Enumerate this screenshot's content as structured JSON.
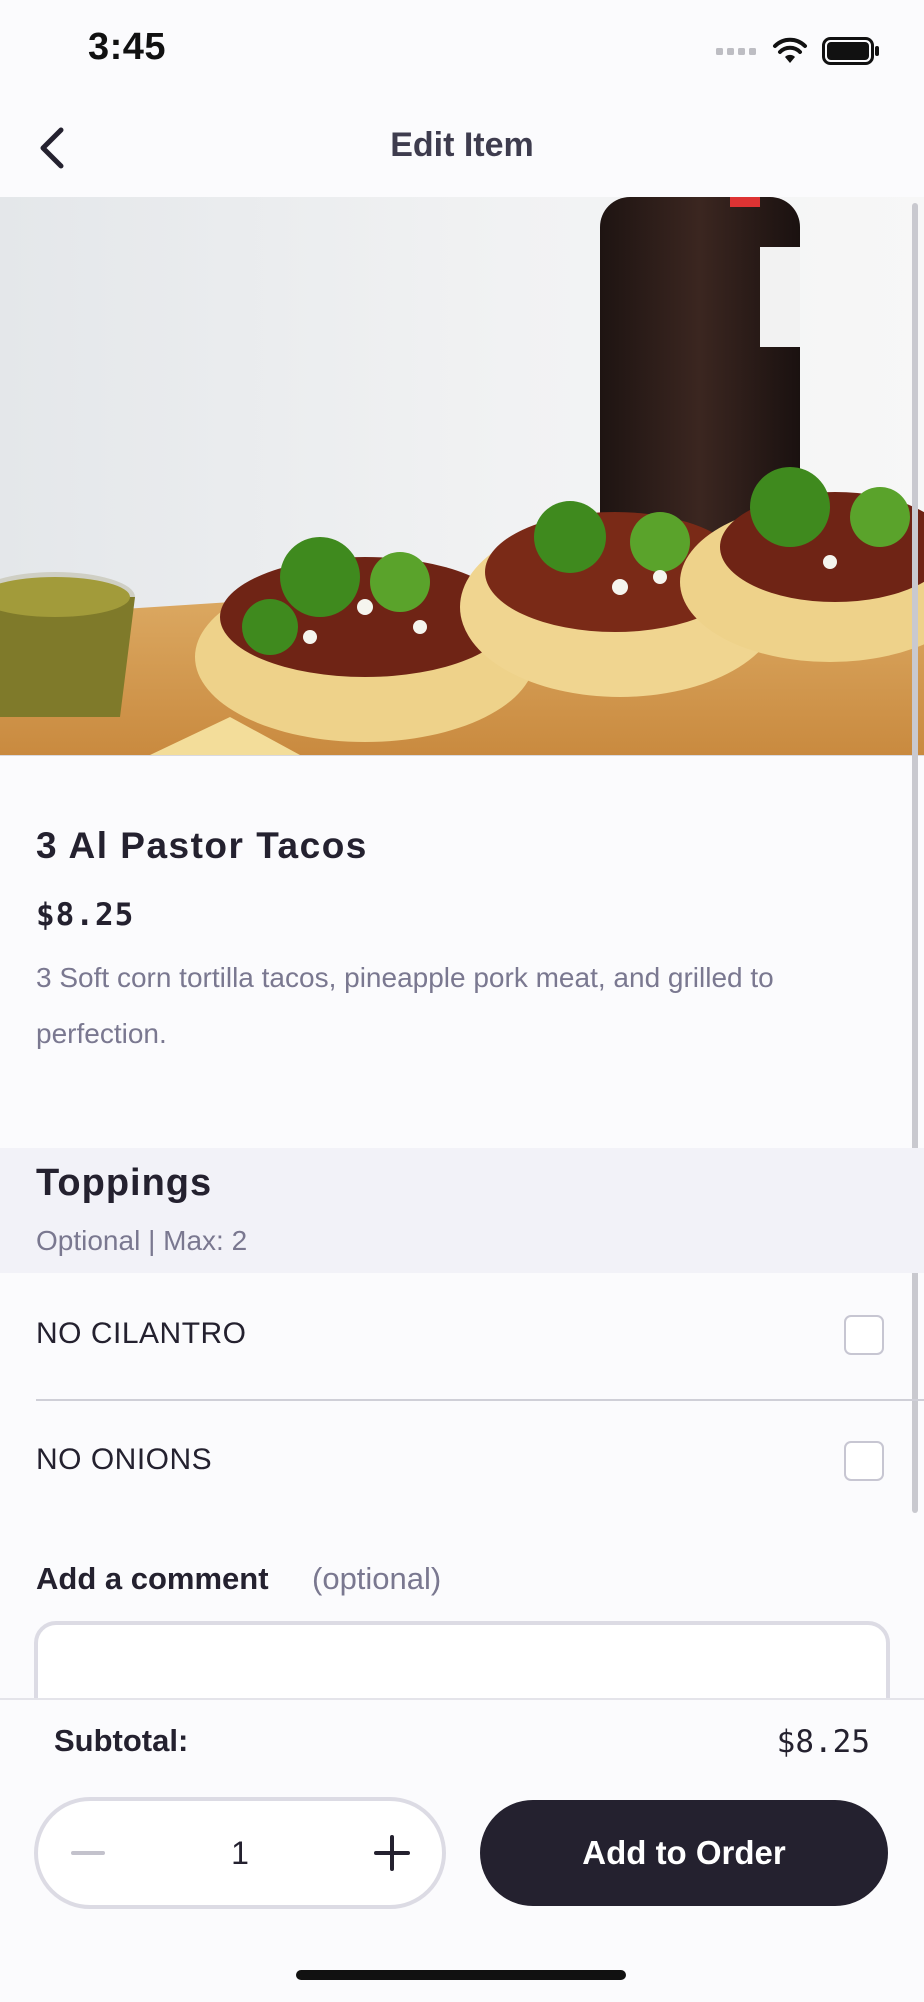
{
  "status_bar": {
    "time": "3:45"
  },
  "nav": {
    "title": "Edit Item"
  },
  "item": {
    "name": "3 Al Pastor Tacos",
    "price": "$8.25",
    "description": "3 Soft corn tortilla tacos, pineapple pork meat, and grilled to perfection."
  },
  "toppings": {
    "title": "Toppings",
    "subtitle": "Optional | Max: 2",
    "options": [
      {
        "label": "NO CILANTRO",
        "checked": false
      },
      {
        "label": "NO ONIONS",
        "checked": false
      }
    ]
  },
  "comment": {
    "label": "Add a comment",
    "optional_label": "(optional)",
    "value": ""
  },
  "footer": {
    "subtotal_label": "Subtotal:",
    "subtotal_value": "$8.25",
    "quantity": "1",
    "add_button_label": "Add to Order"
  },
  "colors": {
    "primary": "#24212f",
    "muted": "#7a7890",
    "section_bg": "#f2f2f8"
  }
}
